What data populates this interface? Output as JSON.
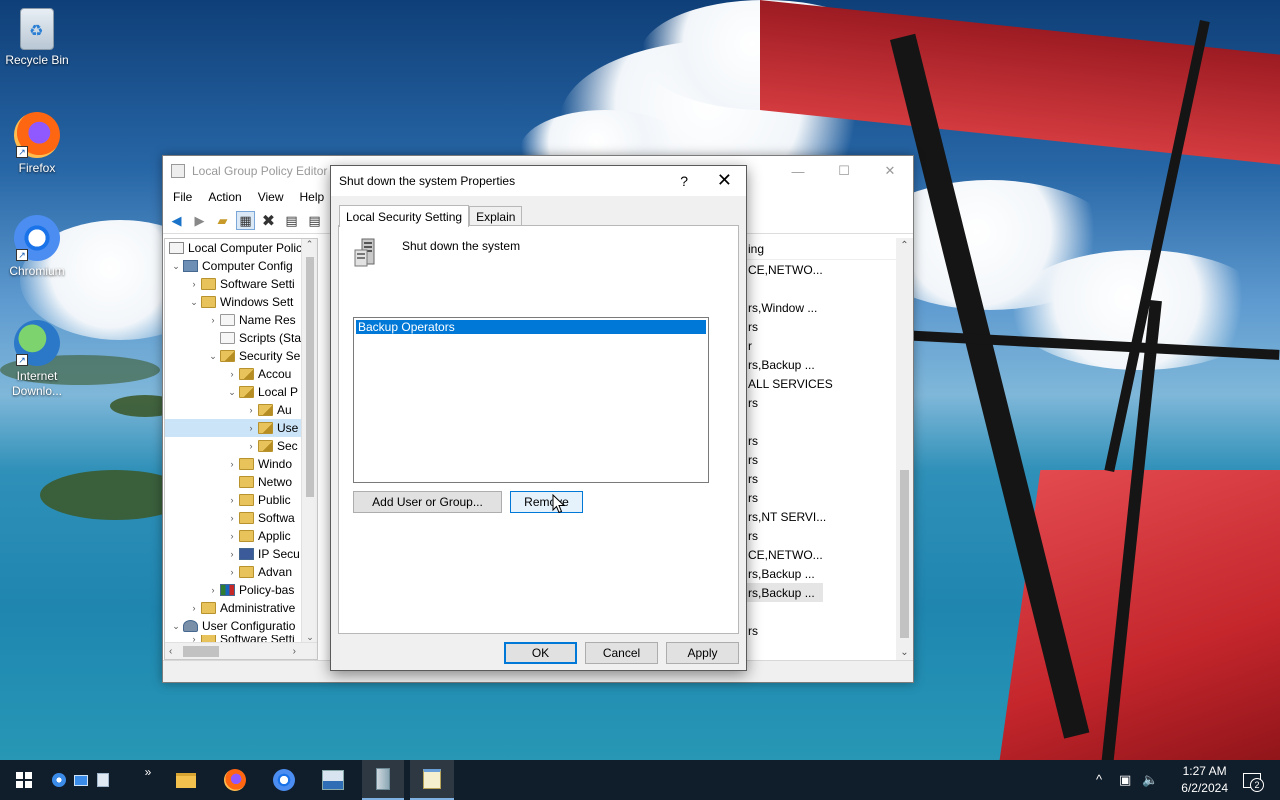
{
  "desktop": {
    "icons": [
      {
        "label": "Recycle Bin"
      },
      {
        "label": "Firefox"
      },
      {
        "label": "Chromium"
      },
      {
        "label": "Internet Downlo..."
      }
    ]
  },
  "gpe": {
    "title": "Local Group Policy Editor",
    "menu": [
      "File",
      "Action",
      "View",
      "Help"
    ],
    "tree": [
      "Local Computer Polic",
      "Computer Config",
      "Software Setti",
      "Windows Sett",
      "Name Res",
      "Scripts (Sta",
      "Security Se",
      "Accou",
      "Local P",
      "Au",
      "Use",
      "Sec",
      "Windo",
      "Netwo",
      "Public",
      "Softwa",
      "Applic",
      "IP Secu",
      "Advan",
      "Policy-bas",
      "Administrative",
      "User Configuratio",
      "Software Setti"
    ],
    "right_col_header": "ing",
    "right_cells": [
      "CE,NETWO...",
      "",
      "rs,Window ...",
      "rs",
      "r",
      "rs,Backup ...",
      "ALL SERVICES",
      "rs",
      "",
      "rs",
      "rs",
      "rs",
      "rs",
      "rs,NT SERVI...",
      "rs",
      "CE,NETWO...",
      "rs,Backup ...",
      "rs,Backup ...",
      "",
      "rs"
    ]
  },
  "dialog": {
    "title": "Shut down the system Properties",
    "help": "?",
    "close": "✕",
    "tabs": [
      "Local Security Setting",
      "Explain"
    ],
    "policy_name": "Shut down the system",
    "list_items": [
      "Backup Operators"
    ],
    "add_button": "Add User or Group...",
    "remove_button": "Remove",
    "ok": "OK",
    "cancel": "Cancel",
    "apply": "Apply"
  },
  "taskbar": {
    "time": "1:27 AM",
    "date": "6/2/2024",
    "notifications": "2",
    "overflow": "»"
  }
}
